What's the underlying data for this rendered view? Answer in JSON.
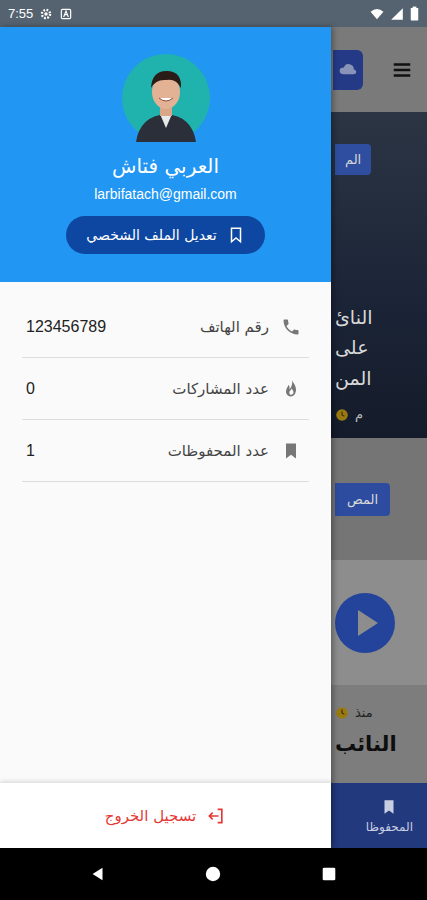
{
  "status_bar": {
    "time": "7:55"
  },
  "profile": {
    "name": "العربي فتاش",
    "email": "larbifatach@gmail.com",
    "edit_button": "تعديل الملف الشخصي"
  },
  "stats": [
    {
      "label": "رقم الهاتف",
      "value": "123456789",
      "kind": "phone"
    },
    {
      "label": "عدد المشاركات",
      "value": "0",
      "kind": "fire"
    },
    {
      "label": "عدد المحفوظات",
      "value": "1",
      "kind": "bookmark"
    }
  ],
  "logout": "تسجيل الخروج",
  "background": {
    "featured": {
      "tag": "الم",
      "title_lines": [
        "النائ",
        "على",
        "المن"
      ],
      "time": "م"
    },
    "section_button": "المص",
    "video": {
      "time": "منذ",
      "title": "النائب"
    },
    "bottom_nav": {
      "label": "المحفوظا",
      "selected": true
    }
  }
}
